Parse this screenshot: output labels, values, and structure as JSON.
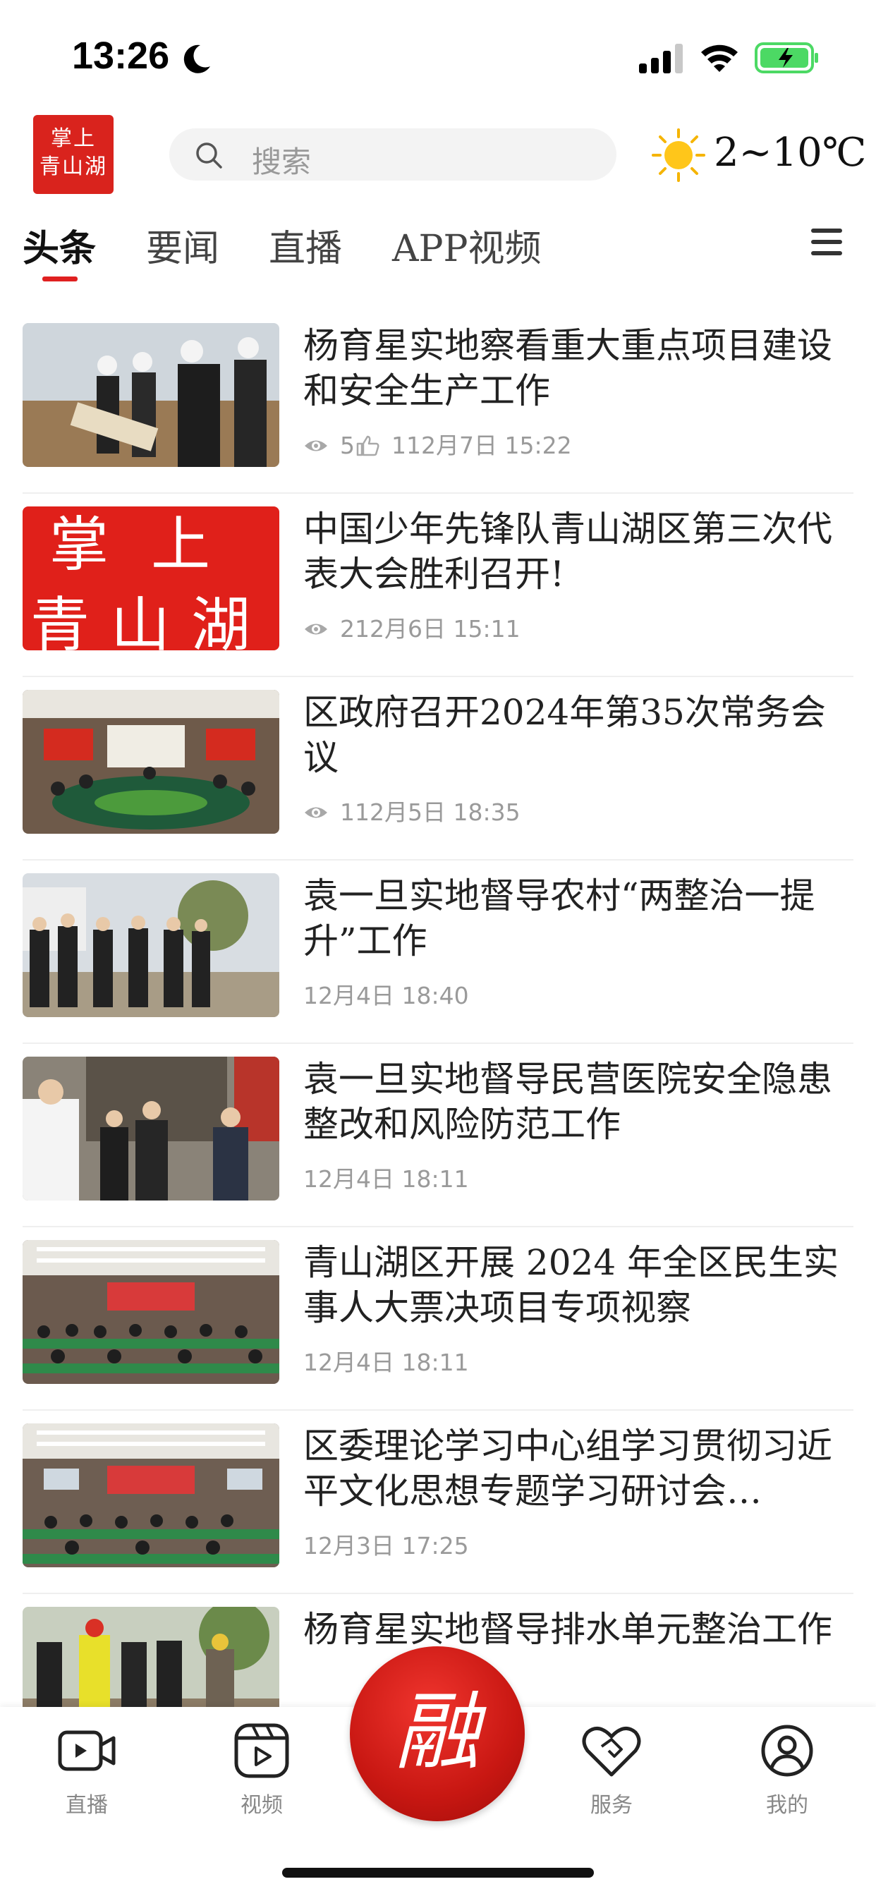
{
  "status_bar": {
    "time": "13:26"
  },
  "header": {
    "logo_line1": "掌上",
    "logo_line2": "青山湖",
    "search_placeholder": "搜索",
    "weather_temp": "2~10℃"
  },
  "tabs": [
    "头条",
    "要闻",
    "直播",
    "APP视频"
  ],
  "active_tab": 0,
  "news": [
    {
      "title": "杨育星实地察看重大重点项目建设和安全生产工作",
      "views": "5",
      "likes": "1",
      "date": "12月7日  15:22"
    },
    {
      "title": "中国少年先锋队青山湖区第三次代表大会胜利召开!",
      "views": "2",
      "likes": null,
      "date": "12月6日  15:11"
    },
    {
      "title": "区政府召开2024年第35次常务会议",
      "views": "1",
      "likes": null,
      "date": "12月5日  18:35"
    },
    {
      "title": "袁一旦实地督导农村“两整治一提升”工作",
      "views": null,
      "likes": null,
      "date": "12月4日  18:40"
    },
    {
      "title": "袁一旦实地督导民营医院安全隐患整改和风险防范工作",
      "views": null,
      "likes": null,
      "date": "12月4日  18:11"
    },
    {
      "title": "青山湖区开展 2024 年全区民生实事人大票决项目专项视察",
      "views": null,
      "likes": null,
      "date": "12月4日  18:11"
    },
    {
      "title": "区委理论学习中心组学习贯彻习近平文化思想专题学习研讨会…",
      "views": null,
      "likes": null,
      "date": "12月3日  17:25"
    },
    {
      "title": "杨育星实地督导排水单元整治工作",
      "views": null,
      "likes": null,
      "date": ""
    }
  ],
  "bottom_nav": {
    "live": "直播",
    "video": "视频",
    "fusion": "融",
    "service": "服务",
    "mine": "我的"
  },
  "colors": {
    "accent": "#e02020",
    "brand_red": "#d9231d"
  }
}
